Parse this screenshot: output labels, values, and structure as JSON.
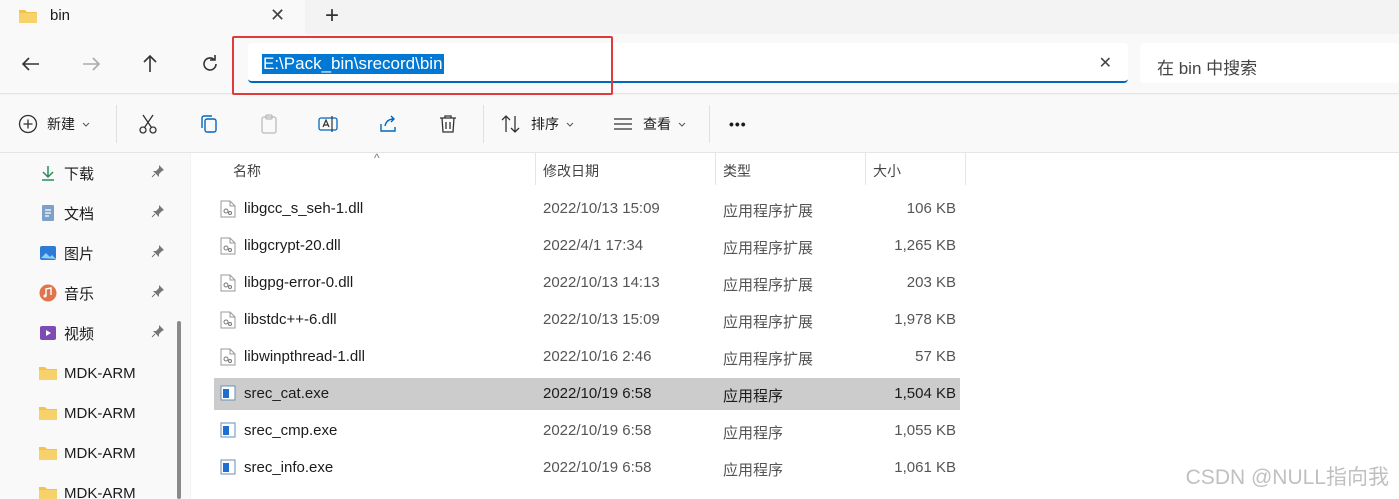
{
  "tab": {
    "title": "bin",
    "close": "✕",
    "new_tab": "+"
  },
  "address": {
    "path": "E:\\Pack_bin\\srecord\\bin",
    "clear": "✕"
  },
  "search": {
    "placeholder": "在 bin 中搜索"
  },
  "commands": {
    "new": "新建",
    "sort": "排序",
    "view": "查看",
    "more": "•••"
  },
  "sidebar": {
    "items": [
      {
        "label": "下载",
        "icon": "download-icon",
        "pinned": true
      },
      {
        "label": "文档",
        "icon": "document-icon",
        "pinned": true
      },
      {
        "label": "图片",
        "icon": "pictures-icon",
        "pinned": true
      },
      {
        "label": "音乐",
        "icon": "music-icon",
        "pinned": true
      },
      {
        "label": "视频",
        "icon": "video-icon",
        "pinned": true
      },
      {
        "label": "MDK-ARM",
        "icon": "folder-icon",
        "pinned": false
      },
      {
        "label": "MDK-ARM",
        "icon": "folder-icon",
        "pinned": false
      },
      {
        "label": "MDK-ARM",
        "icon": "folder-icon",
        "pinned": false
      },
      {
        "label": "MDK-ARM",
        "icon": "folder-icon",
        "pinned": false
      }
    ]
  },
  "columns": {
    "name": "名称",
    "modified": "修改日期",
    "type": "类型",
    "size": "大小"
  },
  "files": [
    {
      "name": "libgcc_s_seh-1.dll",
      "modified": "2022/10/13 15:09",
      "type": "应用程序扩展",
      "size": "106 KB",
      "kind": "dll"
    },
    {
      "name": "libgcrypt-20.dll",
      "modified": "2022/4/1 17:34",
      "type": "应用程序扩展",
      "size": "1,265 KB",
      "kind": "dll"
    },
    {
      "name": "libgpg-error-0.dll",
      "modified": "2022/10/13 14:13",
      "type": "应用程序扩展",
      "size": "203 KB",
      "kind": "dll"
    },
    {
      "name": "libstdc++-6.dll",
      "modified": "2022/10/13 15:09",
      "type": "应用程序扩展",
      "size": "1,978 KB",
      "kind": "dll"
    },
    {
      "name": "libwinpthread-1.dll",
      "modified": "2022/10/16 2:46",
      "type": "应用程序扩展",
      "size": "57 KB",
      "kind": "dll"
    },
    {
      "name": "srec_cat.exe",
      "modified": "2022/10/19 6:58",
      "type": "应用程序",
      "size": "1,504 KB",
      "kind": "exe",
      "selected": true
    },
    {
      "name": "srec_cmp.exe",
      "modified": "2022/10/19 6:58",
      "type": "应用程序",
      "size": "1,055 KB",
      "kind": "exe"
    },
    {
      "name": "srec_info.exe",
      "modified": "2022/10/19 6:58",
      "type": "应用程序",
      "size": "1,061 KB",
      "kind": "exe"
    }
  ],
  "watermark": "CSDN @NULL指向我",
  "colors": {
    "accent": "#0078d4",
    "selection": "#cccccc",
    "annotation": "#e03a3a",
    "folder": "#f2c14e"
  }
}
